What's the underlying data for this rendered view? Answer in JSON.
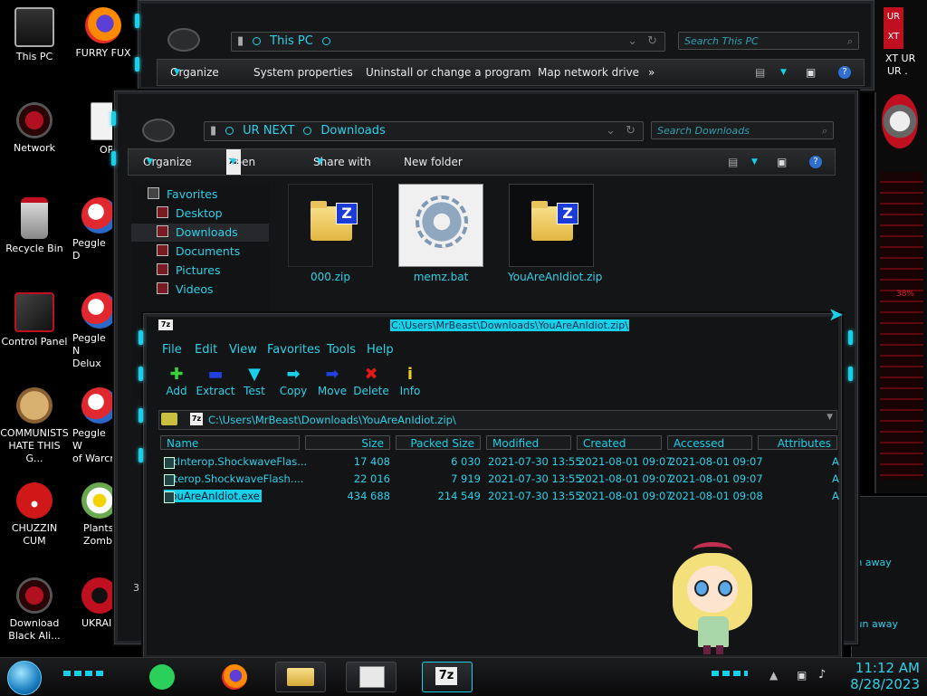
{
  "desktop": {
    "icons": [
      {
        "label": "This PC"
      },
      {
        "label": "FURRY FUX"
      },
      {
        "label": "Network"
      },
      {
        "label": "OPENM"
      },
      {
        "label": "Recycle Bin"
      },
      {
        "label": "Peggle D"
      },
      {
        "label": "Control Panel"
      },
      {
        "label": "Peggle N\nDelux"
      },
      {
        "label": "COMMUNISTS\nHATE THIS G..."
      },
      {
        "label": "Peggle W\nof Warcr"
      },
      {
        "label": "CHUZZIN\nCUM"
      },
      {
        "label": "Plants\nZomb"
      },
      {
        "label": "Download\nBlack Ali..."
      },
      {
        "label": "UKRAINE"
      }
    ],
    "right_edge": {
      "line1": "XT UR",
      "line2": "UR .",
      "tag1": "UR",
      "tag2": "XT",
      "pct": "38%"
    },
    "bottom_right": {
      "text1": "rn away",
      "text2": "run away"
    },
    "partial_digit": "3"
  },
  "win_thispc": {
    "breadcrumb": "This PC",
    "search_placeholder": "Search This PC",
    "toolbar": [
      "Organize",
      "System properties",
      "Uninstall or change a program",
      "Map network drive",
      "»"
    ]
  },
  "win_downloads": {
    "breadcrumb": [
      "UR NEXT",
      "Downloads"
    ],
    "search_placeholder": "Search Downloads",
    "toolbar": {
      "organize": "Organize",
      "open": "Open",
      "share": "Share with",
      "new_folder": "New folder"
    },
    "nav": [
      "Favorites",
      "Desktop",
      "Downloads",
      "Documents",
      "Pictures",
      "Videos"
    ],
    "files": [
      {
        "name": "000.zip"
      },
      {
        "name": "memz.bat"
      },
      {
        "name": "YouAreAnIdiot.zip"
      }
    ]
  },
  "win_7zip": {
    "title": "C:\\Users\\MrBeast\\Downloads\\YouAreAnIdiot.zip\\",
    "icon_text": "7z",
    "menu": [
      "File",
      "Edit",
      "View",
      "Favorites",
      "Tools",
      "Help"
    ],
    "toolbar": [
      {
        "label": "Add",
        "glyph": "✚",
        "color": "#3ad13a"
      },
      {
        "label": "Extract",
        "glyph": "▬",
        "color": "#2040e0"
      },
      {
        "label": "Test",
        "glyph": "▼",
        "color": "#1ad0e8"
      },
      {
        "label": "Copy",
        "glyph": "➡",
        "color": "#1ad0e8"
      },
      {
        "label": "Move",
        "glyph": "➡",
        "color": "#2040e0"
      },
      {
        "label": "Delete",
        "glyph": "✖",
        "color": "#e01818"
      },
      {
        "label": "Info",
        "glyph": "i",
        "color": "#e8d020"
      }
    ],
    "path": "C:\\Users\\MrBeast\\Downloads\\YouAreAnIdiot.zip\\",
    "columns": [
      "Name",
      "Size",
      "Packed Size",
      "Modified",
      "Created",
      "Accessed",
      "Attributes"
    ],
    "rows": [
      {
        "name": "AxInterop.ShockwaveFlas...",
        "size": "17 408",
        "packed": "6 030",
        "modified": "2021-07-30 13:55",
        "created": "2021-08-01 09:07",
        "accessed": "2021-08-01 09:07",
        "attr": "A",
        "selected": false
      },
      {
        "name": "Interop.ShockwaveFlash....",
        "size": "22 016",
        "packed": "7 919",
        "modified": "2021-07-30 13:55",
        "created": "2021-08-01 09:07",
        "accessed": "2021-08-01 09:07",
        "attr": "A",
        "selected": false
      },
      {
        "name": "YouAreAnIdiot.exe",
        "size": "434 688",
        "packed": "214 549",
        "modified": "2021-07-30 13:55",
        "created": "2021-08-01 09:07",
        "accessed": "2021-08-01 09:08",
        "attr": "A",
        "selected": true
      }
    ]
  },
  "taskbar": {
    "apps": [
      "notes-app",
      "firefox",
      "file-explorer",
      "notepad",
      "7-zip"
    ],
    "tz_label": "7z",
    "time": "11:12 AM",
    "date": "8/28/2023"
  },
  "colors": {
    "accent": "#1ad0e8",
    "window_bg": "#141516",
    "hud_red": "#c01020"
  }
}
